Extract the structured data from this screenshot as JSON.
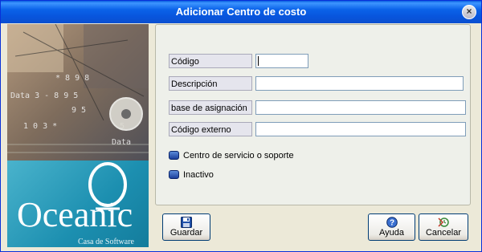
{
  "window": {
    "title": "Adicionar Centro de costo"
  },
  "logo": {
    "brand": "Oceanic",
    "tagline": "Casa de Software"
  },
  "form": {
    "codigo_label": "Código",
    "codigo_value": "",
    "descripcion_label": "Descripción",
    "descripcion_value": "",
    "base_label": "base de asignación",
    "base_value": "",
    "externo_label": "Código externo",
    "externo_value": "",
    "servicio_label": "Centro de servicio o soporte",
    "inactivo_label": "Inactivo"
  },
  "buttons": {
    "guardar": "Guardar",
    "ayuda": "Ayuda",
    "cancelar": "Cancelar"
  },
  "icons": {
    "close": "close-icon",
    "guardar": "floppy-disk-icon",
    "ayuda": "help-icon",
    "cancelar": "cancel-icon"
  }
}
